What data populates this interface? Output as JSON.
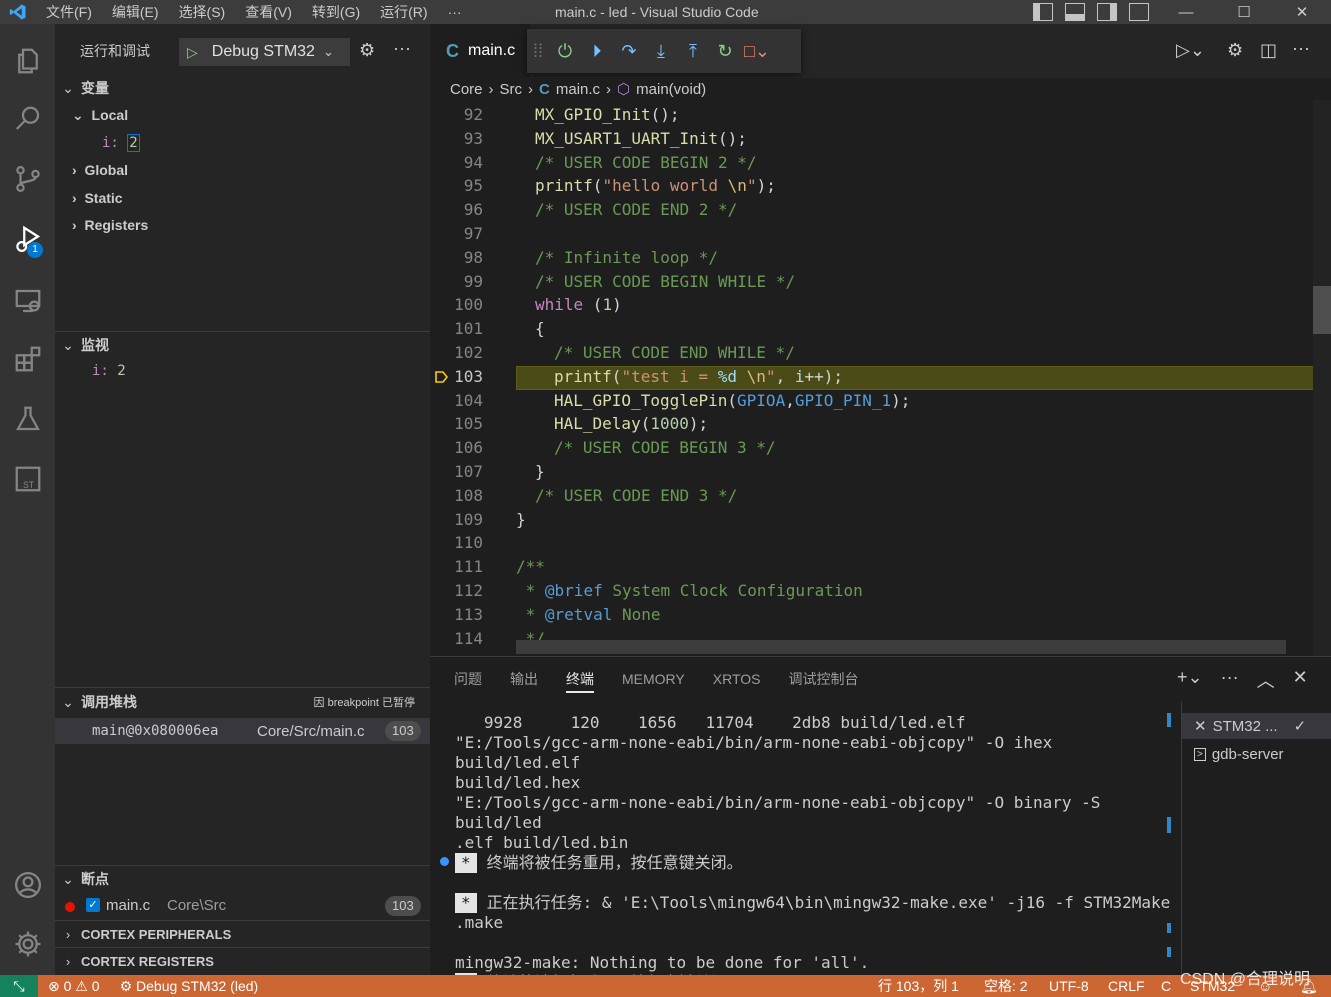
{
  "titlebar": {
    "menu": [
      "文件(F)",
      "编辑(E)",
      "选择(S)",
      "查看(V)",
      "转到(G)",
      "运行(R)",
      "···"
    ],
    "title": "main.c - led - Visual Studio Code",
    "minimize": "—",
    "maximize": "☐",
    "close": "✕"
  },
  "activity": {
    "debug_badge": "1"
  },
  "sidebar": {
    "header": "运行和调试",
    "config_name": "Debug STM32",
    "sections": {
      "variables": "变量",
      "local": "Local",
      "global": "Global",
      "static": "Static",
      "registers": "Registers",
      "watch": "监视",
      "callstack": "调用堆栈",
      "breakpoints": "断点",
      "cortex_peripherals": "CORTEX PERIPHERALS",
      "cortex_registers": "CORTEX REGISTERS"
    },
    "local_var": {
      "name": "i:",
      "value": "2"
    },
    "watch_var": {
      "name": "i:",
      "value": "2"
    },
    "callstack_status": "因 breakpoint 已暂停",
    "stack_frame": {
      "name": "main@0x080006ea",
      "file": "Core/Src/main.c",
      "line": "103"
    },
    "breakpoint": {
      "file": "main.c",
      "path": "Core\\Src",
      "line": "103"
    }
  },
  "editor": {
    "tab": "main.c",
    "breadcrumb": [
      "Core",
      "Src",
      "main.c",
      "main(void)"
    ],
    "lines": [
      {
        "n": "92",
        "html": "<span class=\"fn\">MX_GPIO_Init</span>();",
        "indent": 1
      },
      {
        "n": "93",
        "html": "<span class=\"fn\">MX_USART1_UART_Init</span>();",
        "indent": 1
      },
      {
        "n": "94",
        "html": "<span class=\"cmt\">/* USER CODE BEGIN 2 */</span>",
        "indent": 1
      },
      {
        "n": "95",
        "html": "<span class=\"fn\">printf</span>(<span class=\"str\">\"hello world <span class=\"esc\">\\n</span>\"</span>);",
        "indent": 1
      },
      {
        "n": "96",
        "html": "<span class=\"cmt\">/* USER CODE END 2 */</span>",
        "indent": 1
      },
      {
        "n": "97",
        "html": "",
        "indent": 1
      },
      {
        "n": "98",
        "html": "<span class=\"cmt\">/* Infinite loop */</span>",
        "indent": 1
      },
      {
        "n": "99",
        "html": "<span class=\"cmt\">/* USER CODE BEGIN WHILE */</span>",
        "indent": 1
      },
      {
        "n": "100",
        "html": "<span class=\"kw\">while</span> (<span class=\"num\">1</span>)",
        "indent": 1
      },
      {
        "n": "101",
        "html": "{",
        "indent": 1
      },
      {
        "n": "102",
        "html": "<span class=\"cmt\">/* USER CODE END WHILE */</span>",
        "indent": 2
      },
      {
        "n": "103",
        "html": "<span class=\"fn\">printf</span>(<span class=\"str\">\"test i = <span class=\"vs\">%d</span> <span class=\"esc\">\\n</span>\"</span>, <span class=\"vs\">i</span>++);",
        "indent": 2
      },
      {
        "n": "104",
        "html": "<span class=\"fn\">HAL_GPIO_TogglePin</span>(<span class=\"mac\">GPIOA</span>,<span class=\"mac\">GPIO_PIN_1</span>);",
        "indent": 2
      },
      {
        "n": "105",
        "html": "<span class=\"fn\">HAL_Delay</span>(<span class=\"num\">1000</span>);",
        "indent": 2
      },
      {
        "n": "106",
        "html": "<span class=\"cmt\">/* USER CODE BEGIN 3 */</span>",
        "indent": 2
      },
      {
        "n": "107",
        "html": "}",
        "indent": 1
      },
      {
        "n": "108",
        "html": "<span class=\"cmt\">/* USER CODE END 3 */</span>",
        "indent": 1
      },
      {
        "n": "109",
        "html": "}",
        "indent": 0
      },
      {
        "n": "110",
        "html": "",
        "indent": 0
      },
      {
        "n": "111",
        "html": "<span class=\"cmt\">/**</span>",
        "indent": 0
      },
      {
        "n": "112",
        "html": "<span class=\"cmt\"> * <span class=\"mac\">@brief</span> System Clock Configuration</span>",
        "indent": 0
      },
      {
        "n": "113",
        "html": "<span class=\"cmt\"> * <span class=\"mac\">@retval</span> None</span>",
        "indent": 0
      },
      {
        "n": "114",
        "html": "<span class=\"cmt\"> */</span>",
        "indent": 0
      }
    ],
    "current_line": "103"
  },
  "panel": {
    "tabs": [
      "问题",
      "输出",
      "终端",
      "MEMORY",
      "XRTOS",
      "调试控制台"
    ],
    "active_tab": "终端",
    "terminal_lines": [
      "   9928     120    1656   11704    2db8 build/led.elf",
      "\"E:/Tools/gcc-arm-none-eabi/bin/arm-none-eabi-objcopy\" -O ihex build/led.elf",
      "build/led.hex",
      "\"E:/Tools/gcc-arm-none-eabi/bin/arm-none-eabi-objcopy\" -O binary -S build/led",
      ".elf build/led.bin",
      "* 终端将被任务重用，按任意键关闭。",
      "",
      "* 正在执行任务: & 'E:\\Tools\\mingw64\\bin\\mingw32-make.exe' -j16 -f STM32Make",
      ".make",
      "",
      "mingw32-make: Nothing to be done for 'all'.",
      "* 终端将被任务重用，按任意键关闭。"
    ],
    "terminals": [
      "STM32 ...",
      "gdb-server"
    ]
  },
  "statusbar": {
    "errors": "0",
    "warnings": "0",
    "debug": "Debug STM32 (led)",
    "position": "行 103，列 1",
    "spaces": "空格: 2",
    "encoding": "UTF-8",
    "eol": "CRLF",
    "language": "C",
    "board": "STM32"
  },
  "overlay": {
    "csdn": "CSDN @合理说明"
  },
  "colors": {
    "statusbar": "#cc6633",
    "accent": "#0078d4",
    "highlight": "#4b4b18"
  }
}
